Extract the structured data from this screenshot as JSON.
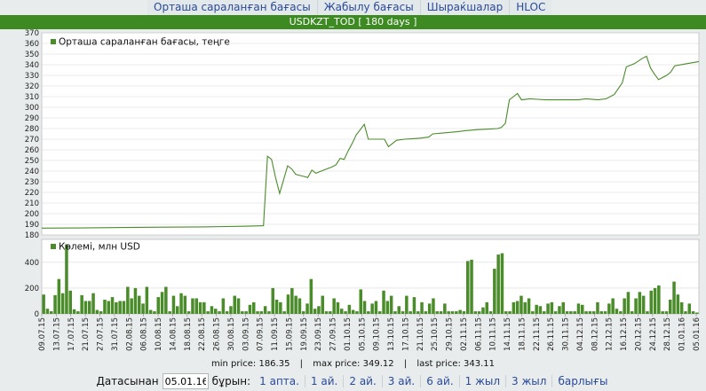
{
  "tabs": [
    "Орташа сараланған бағасы",
    "Жабылу бағасы",
    "Шыраќшалар",
    "HLOC"
  ],
  "title": "USDKZT_TOD [ 180 days ]",
  "stats": {
    "min": "min price: 186.35",
    "sep1": "|",
    "max": "max price: 349.12",
    "sep2": "|",
    "last": "last price: 343.11"
  },
  "controls": {
    "from_label": "Датасынан",
    "date_value": "05.01.16",
    "before_label": "бұрын:",
    "periods": [
      "1 апта.",
      "1 ай.",
      "2 ай.",
      "3 ай.",
      "6 ай.",
      "1 жыл",
      "3 жыл",
      "барлығы"
    ]
  },
  "colors": {
    "series": "#4a8b2a",
    "titlebar": "#3c8a21",
    "grid": "#d8d8d8",
    "link": "#2a4a9a"
  },
  "chart_data": [
    {
      "type": "line",
      "legend": "Орташа сараланған бағасы, теңге",
      "y_ticks": [
        180,
        190,
        200,
        210,
        220,
        230,
        240,
        250,
        260,
        270,
        280,
        290,
        300,
        310,
        320,
        330,
        340,
        350,
        360,
        370
      ],
      "ylim": [
        180,
        370
      ],
      "x_index_range": [
        0,
        124
      ],
      "points": [
        [
          0,
          186.4
        ],
        [
          10,
          186.6
        ],
        [
          20,
          187
        ],
        [
          30,
          187.3
        ],
        [
          40,
          187.6
        ],
        [
          50,
          188.2
        ],
        [
          55,
          188.7
        ],
        [
          56,
          254
        ],
        [
          57,
          251
        ],
        [
          58,
          234
        ],
        [
          59,
          219
        ],
        [
          60,
          232
        ],
        [
          61,
          245
        ],
        [
          62,
          242
        ],
        [
          63,
          237
        ],
        [
          65,
          235
        ],
        [
          66,
          234
        ],
        [
          67,
          241
        ],
        [
          68,
          238
        ],
        [
          70,
          241
        ],
        [
          72,
          244
        ],
        [
          73,
          246
        ],
        [
          74,
          252
        ],
        [
          75,
          251
        ],
        [
          76,
          259
        ],
        [
          77,
          266
        ],
        [
          78,
          274
        ],
        [
          79,
          279
        ],
        [
          80,
          284
        ],
        [
          81,
          270
        ],
        [
          85,
          270
        ],
        [
          86,
          263
        ],
        [
          87,
          266
        ],
        [
          88,
          269
        ],
        [
          90,
          270
        ],
        [
          92,
          270.5
        ],
        [
          94,
          271
        ],
        [
          96,
          272
        ],
        [
          97,
          275
        ],
        [
          100,
          276
        ],
        [
          103,
          277
        ],
        [
          105,
          278
        ],
        [
          108,
          279
        ],
        [
          111,
          279.5
        ],
        [
          113,
          280
        ],
        [
          114,
          281
        ],
        [
          115,
          285
        ],
        [
          116,
          307
        ],
        [
          117,
          310
        ],
        [
          118,
          313
        ],
        [
          119,
          307
        ],
        [
          121,
          308
        ],
        [
          123,
          307.5
        ],
        [
          125,
          307
        ],
        [
          133,
          307
        ],
        [
          135,
          308
        ],
        [
          138,
          307
        ],
        [
          140,
          308
        ],
        [
          142,
          312
        ],
        [
          144,
          323
        ],
        [
          145,
          338
        ],
        [
          147,
          341
        ],
        [
          149,
          346
        ],
        [
          150,
          348
        ],
        [
          151,
          337
        ],
        [
          152,
          331
        ],
        [
          153,
          326
        ],
        [
          154,
          328
        ],
        [
          155,
          330
        ],
        [
          156,
          333
        ],
        [
          157,
          339
        ],
        [
          160,
          341
        ],
        [
          163,
          343
        ]
      ]
    },
    {
      "type": "bar",
      "legend": "Көлемі, млн USD",
      "y_ticks": [
        0,
        200,
        400
      ],
      "ylim": [
        0,
        550
      ],
      "values": [
        150,
        40,
        20,
        145,
        270,
        160,
        540,
        180,
        35,
        20,
        145,
        100,
        100,
        160,
        30,
        20,
        110,
        100,
        130,
        90,
        100,
        100,
        210,
        120,
        200,
        140,
        80,
        210,
        30,
        20,
        130,
        170,
        210,
        20,
        140,
        60,
        160,
        140,
        20,
        120,
        120,
        90,
        90,
        20,
        60,
        40,
        20,
        120,
        20,
        60,
        140,
        120,
        20,
        20,
        70,
        90,
        20,
        20,
        60,
        20,
        200,
        110,
        90,
        20,
        150,
        200,
        140,
        120,
        20,
        80,
        270,
        40,
        60,
        140,
        20,
        20,
        120,
        90,
        40,
        20,
        70,
        30,
        20,
        190,
        100,
        20,
        80,
        100,
        20,
        180,
        100,
        140,
        20,
        60,
        20,
        140,
        20,
        130,
        20,
        90,
        20,
        80,
        120,
        20,
        20,
        80,
        20,
        20,
        20,
        30,
        20,
        410,
        420,
        20,
        20,
        50,
        90,
        20,
        350,
        460,
        470,
        20,
        20,
        90,
        100,
        140,
        90,
        120,
        20,
        70,
        60,
        20,
        80,
        90,
        20,
        60,
        90,
        20,
        20,
        20,
        80,
        70,
        20,
        20,
        20,
        90,
        20,
        20,
        80,
        120,
        40,
        20,
        120,
        170,
        20,
        120,
        170,
        140,
        20,
        180,
        200,
        220,
        20,
        20,
        110,
        250,
        150,
        90,
        20,
        80,
        20,
        10
      ],
      "x_tick_labels": [
        "09.07.15",
        "13.07.15",
        "17.07.15",
        "21.07.15",
        "27.07.15",
        "31.07.15",
        "02.08.15",
        "06.08.15",
        "10.08.15",
        "14.08.15",
        "18.08.15",
        "22.08.15",
        "26.08.15",
        "30.08.15",
        "03.09.15",
        "07.09.15",
        "11.09.15",
        "15.09.15",
        "19.09.15",
        "23.09.15",
        "27.09.15",
        "01.10.15",
        "05.10.15",
        "09.10.15",
        "13.10.15",
        "17.10.15",
        "21.10.15",
        "25.10.15",
        "29.10.15",
        "02.11.15",
        "06.11.15",
        "10.11.15",
        "14.11.15",
        "18.11.15",
        "22.11.15",
        "26.11.15",
        "30.11.15",
        "04.12.15",
        "08.12.15",
        "12.12.15",
        "16.12.15",
        "20.12.15",
        "24.12.15",
        "28.12.15",
        "01.01.16",
        "05.01.16"
      ]
    }
  ]
}
